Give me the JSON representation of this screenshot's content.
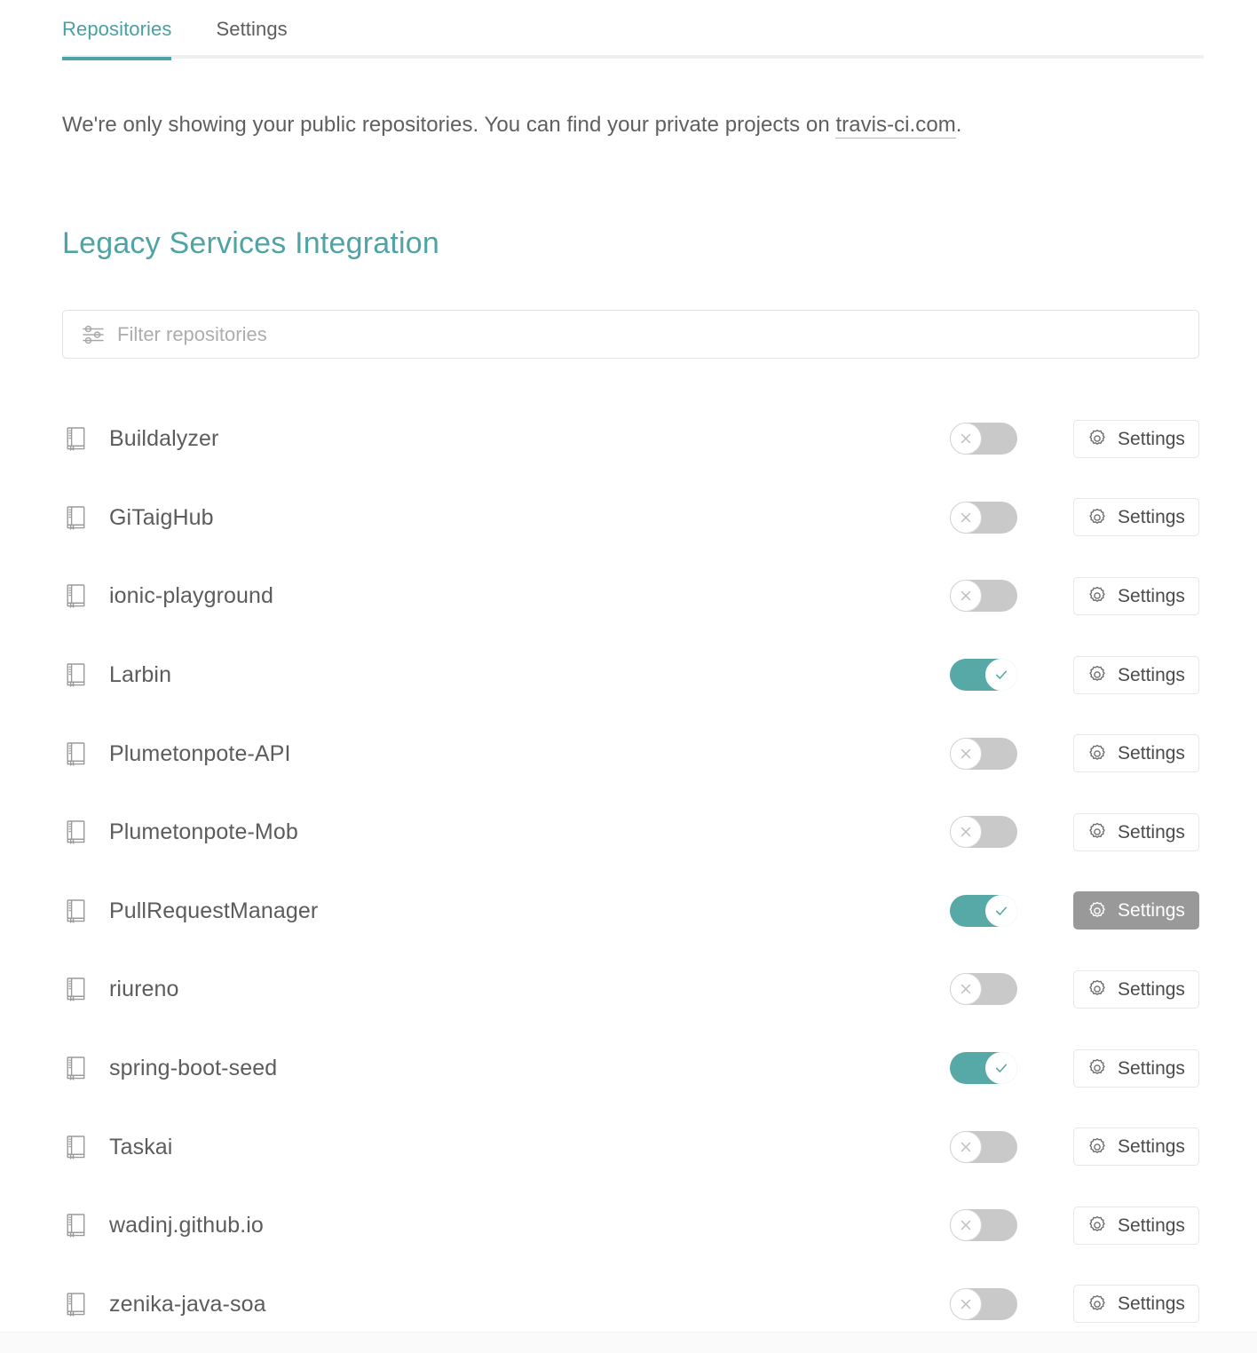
{
  "tabs": [
    {
      "label": "Repositories",
      "active": true
    },
    {
      "label": "Settings",
      "active": false
    }
  ],
  "notice": {
    "text_before": "We're only showing your public repositories. You can find your private projects on ",
    "link_label": "travis-ci.com",
    "text_after": "."
  },
  "section": {
    "title": "Legacy Services Integration"
  },
  "filter": {
    "placeholder": "Filter repositories",
    "value": "",
    "icon": "sliders-filter-icon"
  },
  "colors": {
    "accent_teal": "#4ea3a5",
    "toggle_on": "#56a9a6",
    "toggle_off": "#c9c9c9",
    "text": "#5c5c5c",
    "button_hover_bg": "#999999"
  },
  "settings_button_label": "Settings",
  "repositories": [
    {
      "name": "Buildalyzer",
      "enabled": false,
      "settings_label": "Settings",
      "settings_hover": false
    },
    {
      "name": "GiTaigHub",
      "enabled": false,
      "settings_label": "Settings",
      "settings_hover": false
    },
    {
      "name": "ionic-playground",
      "enabled": false,
      "settings_label": "Settings",
      "settings_hover": false
    },
    {
      "name": "Larbin",
      "enabled": true,
      "settings_label": "Settings",
      "settings_hover": false
    },
    {
      "name": "Plumetonpote-API",
      "enabled": false,
      "settings_label": "Settings",
      "settings_hover": false
    },
    {
      "name": "Plumetonpote-Mob",
      "enabled": false,
      "settings_label": "Settings",
      "settings_hover": false
    },
    {
      "name": "PullRequestManager",
      "enabled": true,
      "settings_label": "Settings",
      "settings_hover": true
    },
    {
      "name": "riureno",
      "enabled": false,
      "settings_label": "Settings",
      "settings_hover": false
    },
    {
      "name": "spring-boot-seed",
      "enabled": true,
      "settings_label": "Settings",
      "settings_hover": false
    },
    {
      "name": "Taskai",
      "enabled": false,
      "settings_label": "Settings",
      "settings_hover": false
    },
    {
      "name": "wadinj.github.io",
      "enabled": false,
      "settings_label": "Settings",
      "settings_hover": false
    },
    {
      "name": "zenika-java-soa",
      "enabled": false,
      "settings_label": "Settings",
      "settings_hover": false
    }
  ]
}
